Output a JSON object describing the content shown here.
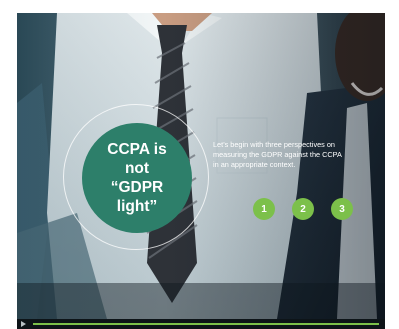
{
  "slide": {
    "hero_title": "CCPA is\nnot\n“GDPR\nlight”",
    "intro_text": "Let’s begin with three perspectives on measuring the GDPR against the CCPA in an appropriate context.",
    "steps": [
      {
        "label": "1"
      },
      {
        "label": "2"
      },
      {
        "label": "3"
      }
    ]
  },
  "player": {
    "progress_fraction": 1.0
  },
  "colors": {
    "hero_circle": "#2d7f6a",
    "step_button": "#7cc04a",
    "progress": "#7cc04a"
  }
}
